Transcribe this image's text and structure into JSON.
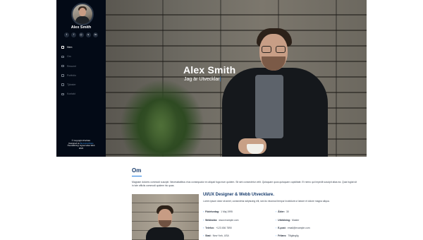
{
  "sidebar": {
    "name": "Alex Smith",
    "socials": [
      {
        "icon": "twitter-icon",
        "glyph": "t"
      },
      {
        "icon": "facebook-icon",
        "glyph": "f"
      },
      {
        "icon": "instagram-icon",
        "glyph": "◎"
      },
      {
        "icon": "skype-icon",
        "glyph": "s"
      },
      {
        "icon": "linkedin-icon",
        "glyph": "in"
      }
    ],
    "nav": [
      {
        "label": "Hem",
        "icon": "home-icon",
        "active": true
      },
      {
        "label": "Om",
        "icon": "user-icon",
        "active": false
      },
      {
        "label": "Resumé",
        "icon": "file-icon",
        "active": false
      },
      {
        "label": "Portfolio",
        "icon": "book-icon",
        "active": false
      },
      {
        "label": "Tjänster",
        "icon": "server-icon",
        "active": false
      },
      {
        "label": "Kontakt",
        "icon": "envelope-icon",
        "active": false
      }
    ],
    "footer": {
      "copyright": "© Copyright iPortfolio",
      "designed_by_prefix": "Designed av",
      "designed_by_link": "BootstrapMade",
      "line3": "Översättning: Hypercodes Web",
      "line4": "2023"
    }
  },
  "hero": {
    "title": "Alex Smith",
    "subtitle": "Jag är Utvecklar",
    "caret": "|"
  },
  "about": {
    "title": "Om",
    "intro": "Magnam dolores commodi suscipit. Necessitatibus eius consequatur ex aliquid fuga eum quidem. Sit sint consectetur velit. Quisquam quos quisquam cupiditate. Et nemo qui impedit suscipit alias ea. Quia fugiat sit in iste officiis commodi quidem hic quas.",
    "role_title": "UI/UX Designer & Webb Utvecklare.",
    "role_text": "Lorem ipsum dolor sit amet, consectetur adipiscing elit, sed do eiusmod tempor incididunt ut labore et dolore magna aliqua.",
    "details": [
      {
        "k": "Födelsedag:",
        "v": "1 Maj 1995"
      },
      {
        "k": "Ålder:",
        "v": "30"
      },
      {
        "k": "Webbsida:",
        "v": "www.example.com"
      },
      {
        "k": "Utbildning:",
        "v": "Master"
      },
      {
        "k": "Telefon:",
        "v": "+123 456 7890"
      },
      {
        "k": "E-post:",
        "v": "email@example.com"
      },
      {
        "k": "Stad:",
        "v": "New York, USA"
      },
      {
        "k": "Frilans:",
        "v": "Tillgänglig"
      }
    ]
  },
  "colors": {
    "sidebar_bg": "#030a16",
    "accent": "#1f7be0",
    "heading": "#173b6c"
  }
}
